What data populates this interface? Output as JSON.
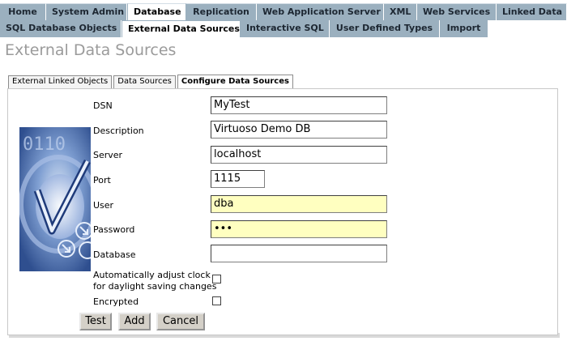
{
  "main_tabs": [
    {
      "label": "Home"
    },
    {
      "label": "System Admin"
    },
    {
      "label": "Database"
    },
    {
      "label": "Replication"
    },
    {
      "label": "Web Application Server"
    },
    {
      "label": "XML"
    },
    {
      "label": "Web Services"
    },
    {
      "label": "Linked Data"
    }
  ],
  "sub_tabs": [
    {
      "label": "SQL Database Objects"
    },
    {
      "label": "External Data Sources"
    },
    {
      "label": "Interactive SQL"
    },
    {
      "label": "User Defined Types"
    },
    {
      "label": "Import"
    }
  ],
  "page_title": "External Data Sources",
  "section_tabs": [
    {
      "label": "External Linked Objects"
    },
    {
      "label": "Data Sources"
    },
    {
      "label": "Configure Data Sources"
    }
  ],
  "form": {
    "dsn": {
      "label": "DSN",
      "value": "MyTest"
    },
    "description": {
      "label": "Description",
      "value": "Virtuoso Demo DB"
    },
    "server": {
      "label": "Server",
      "value": "localhost"
    },
    "port": {
      "label": "Port",
      "value": "1115"
    },
    "user": {
      "label": "User",
      "value": "dba"
    },
    "password": {
      "label": "Password",
      "value": "•••"
    },
    "database": {
      "label": "Database",
      "value": ""
    },
    "adjust_clock": {
      "label_line1": "Automatically adjust clock",
      "label_line2": "for daylight saving changes",
      "checked": false
    },
    "encrypted": {
      "label": "Encrypted",
      "checked": false
    }
  },
  "buttons": {
    "test": "Test",
    "add": "Add",
    "cancel": "Cancel"
  },
  "art_text": "0110",
  "colors": {
    "tab_bg": "#9bb0bf",
    "highlight_field": "#ffffc0",
    "title_gray": "#9b9b9b"
  }
}
